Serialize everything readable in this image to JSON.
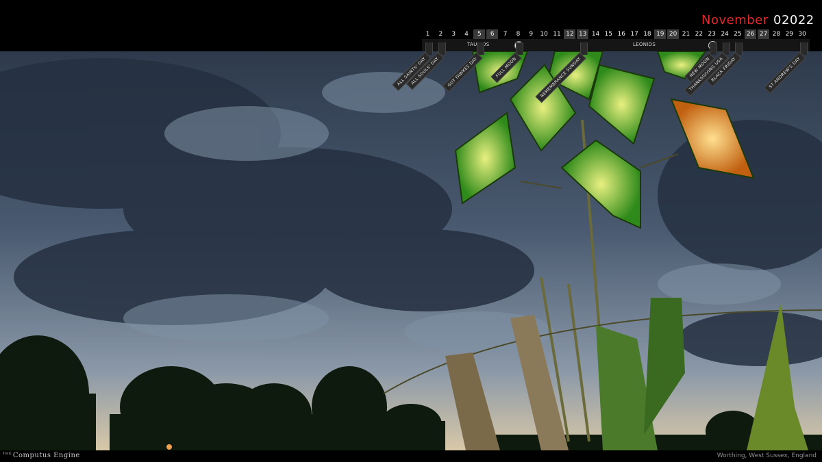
{
  "header": {
    "month": "November",
    "year": "02022"
  },
  "calendar": {
    "days": [
      "1",
      "2",
      "3",
      "4",
      "5",
      "6",
      "7",
      "8",
      "9",
      "10",
      "11",
      "12",
      "13",
      "14",
      "15",
      "16",
      "17",
      "18",
      "19",
      "20",
      "21",
      "22",
      "23",
      "24",
      "25",
      "26",
      "27",
      "28",
      "29",
      "30"
    ],
    "weekend_days": [
      "5",
      "6",
      "12",
      "13",
      "19",
      "20",
      "26",
      "27"
    ],
    "showers": [
      "TAURIDS",
      "LEONIDS"
    ],
    "moons": [
      {
        "name": "full-moon",
        "day": "8",
        "color": "#f2f2f2"
      },
      {
        "name": "new-moon",
        "day": "23",
        "color": "#111111"
      }
    ],
    "events": [
      {
        "label": "ALL SAINTS' DAY",
        "day": "1"
      },
      {
        "label": "ALL SOULS' DAY",
        "day": "2"
      },
      {
        "label": "GUY FAWKES DAY",
        "day": "5"
      },
      {
        "label": "FULL MOON",
        "day": "8"
      },
      {
        "label": "REMEMBRANCE SUNDAY",
        "day": "13"
      },
      {
        "label": "NEW MOON",
        "day": "23"
      },
      {
        "label": "THANKSGIVING USA",
        "day": "24"
      },
      {
        "label": "BLACK FRIDAY",
        "day": "25"
      },
      {
        "label": "ST ANDREW'S DAY",
        "day": "30"
      }
    ]
  },
  "footer": {
    "brand_prefix": "THE",
    "brand": "Computus Engine",
    "location": "Worthing, West Sussex, England"
  },
  "colors": {
    "month_red": "#e0292a",
    "lantern_green": "#5fd43a",
    "lantern_orange": "#f0a030"
  }
}
